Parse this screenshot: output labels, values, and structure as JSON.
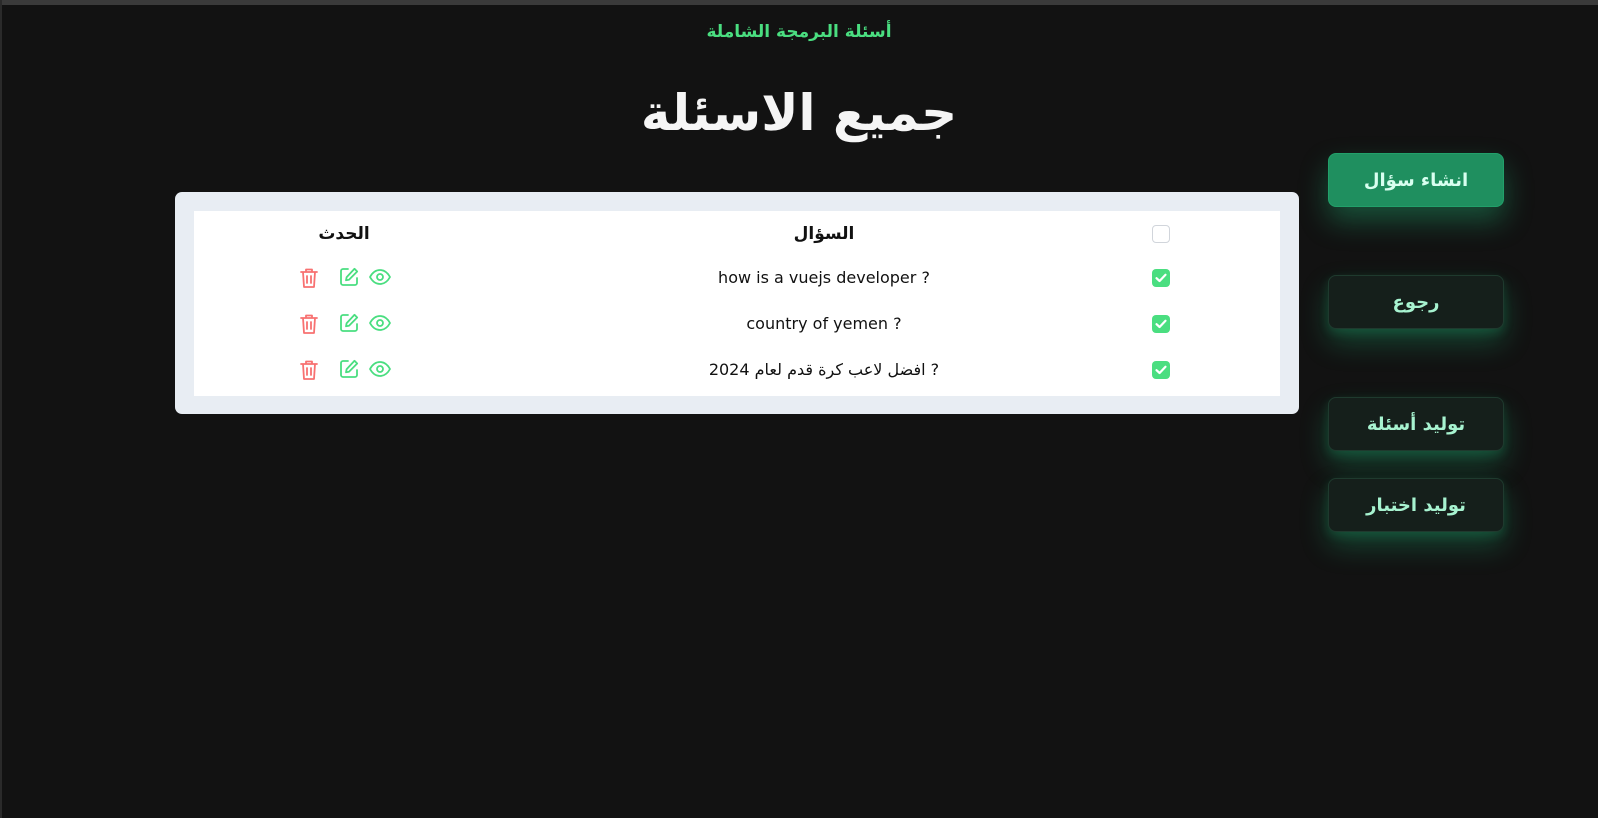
{
  "header": {
    "site_title": "أسئلة البرمجة الشاملة",
    "page_title": "جميع الاسئلة"
  },
  "table": {
    "columns": {
      "question": "السؤال",
      "action": "الحدث"
    },
    "header_checkbox_checked": false,
    "rows": [
      {
        "question": "how is a vuejs developer ?",
        "checked": true
      },
      {
        "question": "country of yemen ?",
        "checked": true
      },
      {
        "question": "افضل لاعب كرة قدم لعام 2024 ?",
        "checked": true
      }
    ],
    "row_actions": [
      "delete-icon",
      "edit-icon",
      "eye-icon"
    ]
  },
  "sidebar": {
    "buttons": [
      {
        "label": "انشاء سؤال",
        "style": "primary"
      },
      {
        "label": "رجوع",
        "style": "secondary"
      },
      {
        "label": "توليد أسئلة",
        "style": "secondary"
      },
      {
        "label": "توليد اختبار",
        "style": "secondary"
      }
    ]
  },
  "colors": {
    "background": "#121212",
    "accent": "#4ade80",
    "primary_button": "#1f8f5f",
    "delete": "#f87171",
    "card": "#e8edf3"
  }
}
